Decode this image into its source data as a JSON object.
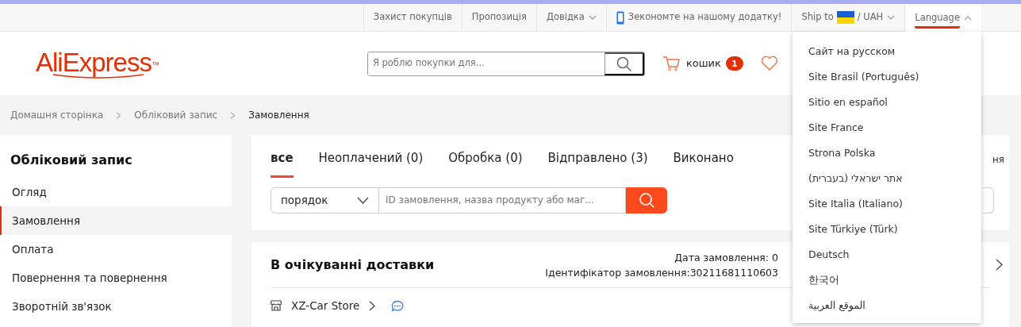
{
  "top_bar": {
    "items": [
      {
        "kind": "link",
        "label": "Захист покупців"
      },
      {
        "kind": "link",
        "label": "Пропозиція"
      },
      {
        "kind": "menu",
        "label": "Довідка",
        "expanded": false
      },
      {
        "kind": "app",
        "label": "Зекономте на нашому додатку!"
      },
      {
        "kind": "ship",
        "label": "Ship to",
        "separator": "/",
        "currency": "UAH"
      },
      {
        "kind": "menu",
        "label": "Language",
        "expanded": true,
        "menu_items": [
          "Сайт на русском",
          "Site Brasil (Português)",
          "Sitio en español",
          "Site France",
          "Strona Polska",
          "אתר ישראלי (בעברית)",
          "Site Italia (Italiano)",
          "Site Türkiye (Türk)",
          "Deutsch",
          "한국어",
          "الموقع العربية"
        ]
      }
    ]
  },
  "header": {
    "logo": "AliExpress",
    "logo_mark": "™",
    "search": {
      "placeholder": "Я роблю покупки для..."
    },
    "cart": {
      "label": "кошик",
      "count": "1"
    }
  },
  "breadcrumb": [
    "Домашня сторінка",
    "Обліковий запис",
    "Замовлення"
  ],
  "sidebar": {
    "title": "Обліковий запис",
    "items": [
      {
        "label": "Огляд",
        "selected": false
      },
      {
        "label": "Замовлення",
        "selected": true
      },
      {
        "label": "Оплата",
        "selected": false
      },
      {
        "label": "Повернення та повернення",
        "selected": false
      },
      {
        "label": "Зворотній зв'язок",
        "selected": false
      }
    ]
  },
  "tabs": [
    {
      "label": "все",
      "selected": true
    },
    {
      "label": "Неоплачений (0)",
      "selected": false
    },
    {
      "label": "Обробка (0)",
      "selected": false
    },
    {
      "label": "Відправлено (3)",
      "selected": false
    },
    {
      "label": "Виконано",
      "selected": false
    }
  ],
  "tabs_side_text": "ня",
  "filter": {
    "select_value": "порядок",
    "placeholder": "ID замовлення, назва продукту або маг..."
  },
  "order": {
    "status": "В очікуванні доставки",
    "date": "Дата замовлення: 0",
    "id": "Ідентифікатор замовлення:30211681110603",
    "store": "XZ-Car Store"
  }
}
